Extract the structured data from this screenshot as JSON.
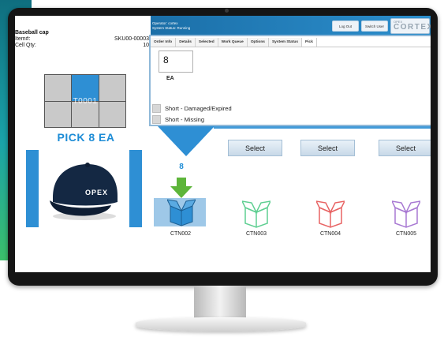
{
  "header": {
    "operator_line": "Operator:  cortex",
    "status_line": "System Status:  Running",
    "logout_label": "Log Out",
    "switch_label": "Switch User",
    "brand_small": "OPEX",
    "brand_main": "CORTEX"
  },
  "item": {
    "name": "Baseball cap",
    "item_label": "Item#:",
    "item_value": "SKU00-00003",
    "cell_qty_label": "Cell Qty:",
    "cell_qty_value": "10"
  },
  "grid": {
    "label": "T0001",
    "active_cell": 2
  },
  "pick_instruction": "PICK 8 EA",
  "product_logo": "OPEX",
  "tabs": [
    "Order Info",
    "Details",
    "Selected",
    "Work Queue",
    "Options",
    "System Status",
    "Pick"
  ],
  "active_tab": "Pick",
  "pick_panel": {
    "quantity": "8",
    "unit": "EA",
    "options": [
      "Short - Damaged/Expired",
      "Short - Missing"
    ]
  },
  "select_label": "Select",
  "place_count": "8",
  "cartons": [
    {
      "label": "CTN002",
      "color": "#2e8fd4"
    },
    {
      "label": "CTN003",
      "color": "#5fcf92"
    },
    {
      "label": "CTN004",
      "color": "#e86464"
    },
    {
      "label": "CTN005",
      "color": "#a879d3"
    }
  ],
  "colors": {
    "accent": "#1d8cd6",
    "arrow": "#5db53a"
  }
}
